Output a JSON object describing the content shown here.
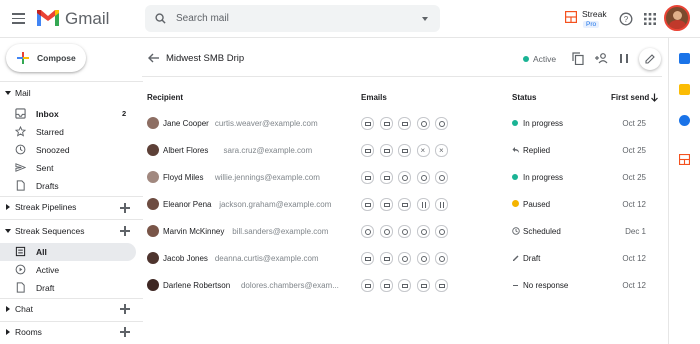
{
  "app": {
    "name": "Gmail"
  },
  "search": {
    "placeholder": "Search mail"
  },
  "streak": {
    "name": "Streak",
    "badge": "Pro"
  },
  "compose": {
    "label": "Compose"
  },
  "sidebar": {
    "mail_section": "Mail",
    "mail_items": [
      {
        "label": "Inbox",
        "count": "2"
      },
      {
        "label": "Starred"
      },
      {
        "label": "Snoozed"
      },
      {
        "label": "Sent"
      },
      {
        "label": "Drafts"
      }
    ],
    "pipelines_section": "Streak Pipelines",
    "sequences_section": "Streak Sequences",
    "sequence_items": [
      {
        "label": "All"
      },
      {
        "label": "Active"
      },
      {
        "label": "Draft"
      }
    ],
    "chat_section": "Chat",
    "rooms_section": "Rooms"
  },
  "sequence": {
    "title": "Midwest SMB Drip",
    "status": "Active",
    "status_color": "#1ab394"
  },
  "table": {
    "headers": {
      "recipient": "Recipient",
      "emails": "Emails",
      "status": "Status",
      "first_send": "First send"
    },
    "rows": [
      {
        "name": "Jane Cooper",
        "email": "curtis.weaver@example.com",
        "pills": [
          "env",
          "env",
          "env",
          "clock",
          "clock"
        ],
        "status": "In progress",
        "status_kind": "dot-green",
        "date": "Oct 25",
        "avatar_color": "#8d6e63"
      },
      {
        "name": "Albert Flores",
        "email": "sara.cruz@example.com",
        "pills": [
          "env",
          "env",
          "env",
          "x",
          "x"
        ],
        "status": "Replied",
        "status_kind": "reply",
        "date": "Oct 25",
        "avatar_color": "#5d4037"
      },
      {
        "name": "Floyd Miles",
        "email": "willie.jennings@example.com",
        "pills": [
          "env",
          "env",
          "clock",
          "clock",
          "clock"
        ],
        "status": "In progress",
        "status_kind": "dot-green",
        "date": "Oct 25",
        "avatar_color": "#a1887f"
      },
      {
        "name": "Eleanor Pena",
        "email": "jackson.graham@example.com",
        "pills": [
          "env",
          "env",
          "env",
          "pause",
          "pause"
        ],
        "status": "Paused",
        "status_kind": "dot-orange",
        "date": "Oct 12",
        "avatar_color": "#6d4c41"
      },
      {
        "name": "Marvin McKinney",
        "email": "bill.sanders@example.com",
        "pills": [
          "clock",
          "clock",
          "clock",
          "clock",
          "clock"
        ],
        "status": "Scheduled",
        "status_kind": "clock",
        "date": "Dec 1",
        "avatar_color": "#795548"
      },
      {
        "name": "Jacob Jones",
        "email": "deanna.curtis@example.com",
        "pills": [
          "env",
          "env",
          "clock",
          "clock",
          "clock"
        ],
        "status": "Draft",
        "status_kind": "pencil",
        "date": "Oct 12",
        "avatar_color": "#4e342e"
      },
      {
        "name": "Darlene Robertson",
        "email": "dolores.chambers@exam...",
        "pills": [
          "env",
          "env",
          "env",
          "env",
          "env"
        ],
        "status": "No response",
        "status_kind": "dash",
        "date": "Oct 12",
        "avatar_color": "#3e2723"
      }
    ]
  }
}
